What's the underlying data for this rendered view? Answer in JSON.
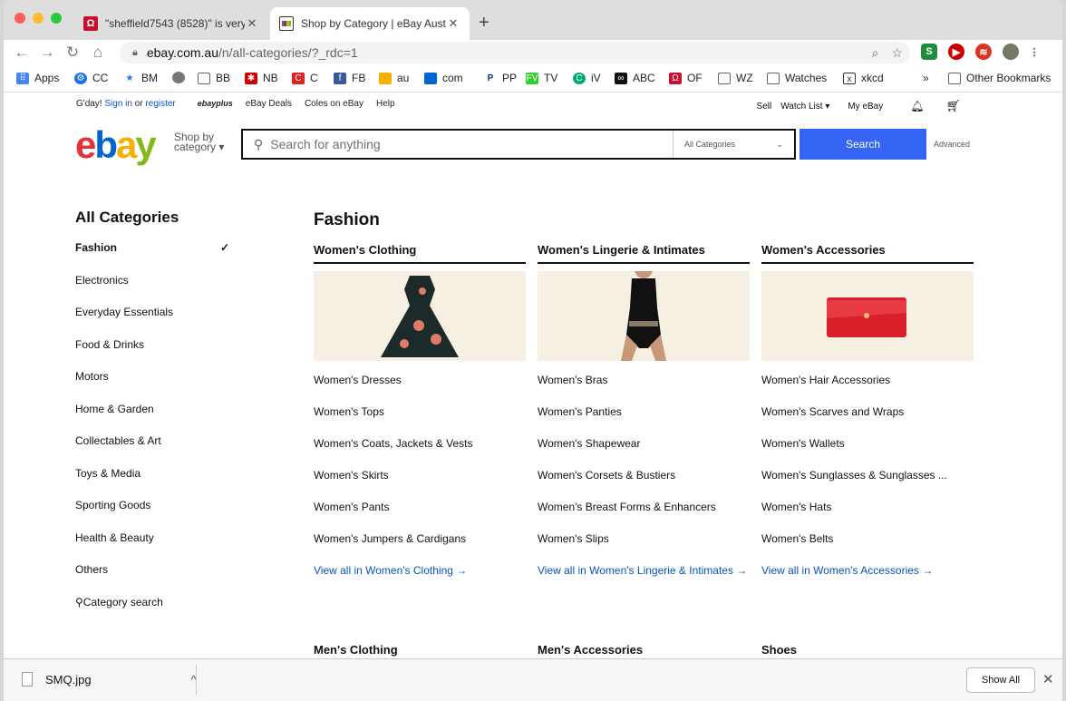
{
  "browser": {
    "tabs": [
      {
        "title": "\"sheffield7543 (8528)\" is very",
        "close": "✕"
      },
      {
        "title": "Shop by Category | eBay Austr",
        "close": "✕"
      }
    ],
    "new_tab": "+",
    "url_domain": "ebay.com.au",
    "url_path": "/n/all-categories/?_rdc=1",
    "back": "←",
    "forward": "→",
    "reload": "↻",
    "home": "⌂",
    "bookmarks": [
      "Apps",
      "CC",
      "BM",
      "",
      "BB",
      "NB",
      "C",
      "FB",
      "au",
      "com",
      "PP",
      "TV",
      "iV",
      "ABC",
      "OF",
      "WZ",
      "Watches",
      "xkcd",
      "»",
      "Other Bookmarks"
    ]
  },
  "header": {
    "greeting": "G'day!",
    "sign_in": "Sign in",
    "or": "or",
    "register": "register",
    "ebayplus": "ebayplus",
    "deals": "eBay Deals",
    "coles": "Coles on eBay",
    "help": "Help",
    "sell": "Sell",
    "watch_list": "Watch List ▾",
    "my_ebay": "My eBay",
    "shop_by_1": "Shop by",
    "shop_by_2": "category",
    "search_placeholder": "Search for anything",
    "all_categories": "All Categories",
    "search_button": "Search",
    "advanced": "Advanced"
  },
  "sidebar": {
    "title": "All Categories",
    "items": [
      "Fashion",
      "Electronics",
      "Everyday Essentials",
      "Food & Drinks",
      "Motors",
      "Home & Garden",
      "Collectables & Art",
      "Toys & Media",
      "Sporting Goods",
      "Health & Beauty",
      "Others",
      "Category search"
    ],
    "check": "✓"
  },
  "main": {
    "title": "Fashion",
    "columns": [
      {
        "heading": "Women's Clothing",
        "links": [
          "Women's Dresses",
          "Women's Tops",
          "Women's Coats, Jackets & Vests",
          "Women's Skirts",
          "Women's Pants",
          "Women's Jumpers & Cardigans"
        ],
        "view_all": "View all in Women's Clothing →"
      },
      {
        "heading": "Women's Lingerie & Intimates",
        "links": [
          "Women's Bras",
          "Women's Panties",
          "Women's Shapewear",
          "Women's Corsets & Bustiers",
          "Women's Breast Forms & Enhancers",
          "Women's Slips"
        ],
        "view_all": "View all in Women's Lingerie & Intimates →"
      },
      {
        "heading": "Women's Accessories",
        "links": [
          "Women's Hair Accessories",
          "Women's Scarves and Wraps",
          "Women's Wallets",
          "Women's Sunglasses & Sunglasses ...",
          "Women's Hats",
          "Women's Belts"
        ],
        "view_all": "View all in Women's Accessories →"
      }
    ],
    "next_headings": [
      "Men's Clothing",
      "Men's Accessories",
      "Shoes"
    ]
  },
  "downloads": {
    "file": "SMQ.jpg",
    "show_all": "Show All",
    "close": "✕",
    "chevron": "^"
  },
  "colors": {
    "ebay_e": "#e53238",
    "ebay_b": "#0064d2",
    "ebay_a": "#f5af02",
    "ebay_y": "#86b817",
    "link": "#0654ba",
    "search_btn": "#3665f3"
  }
}
